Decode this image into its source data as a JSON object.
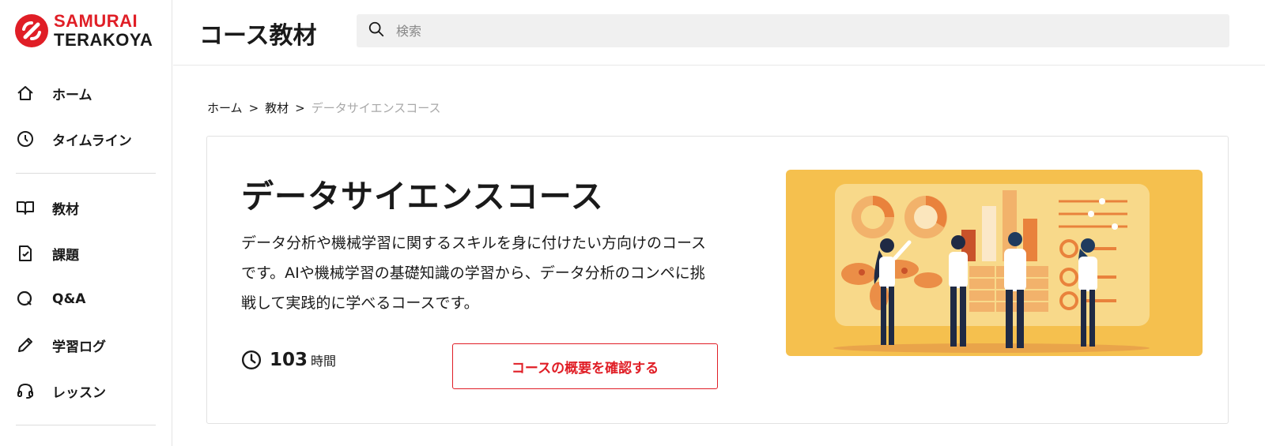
{
  "brand": {
    "line1": "SAMURAI",
    "line2": "TERAKOYA",
    "accent_color": "#e01e26"
  },
  "sidebar": {
    "items": [
      {
        "label": "ホーム",
        "icon": "home-icon"
      },
      {
        "label": "タイムライン",
        "icon": "clock-icon"
      },
      {
        "label": "教材",
        "icon": "book-icon"
      },
      {
        "label": "課題",
        "icon": "assignment-icon"
      },
      {
        "label": "Q&A",
        "icon": "qa-icon"
      },
      {
        "label": "学習ログ",
        "icon": "pencil-icon"
      },
      {
        "label": "レッスン",
        "icon": "headset-icon"
      }
    ]
  },
  "header": {
    "title": "コース教材",
    "search_placeholder": "検索"
  },
  "breadcrumb": {
    "home": "ホーム",
    "materials": "教材",
    "current": "データサイエンスコース",
    "separator": ">"
  },
  "course": {
    "title": "データサイエンスコース",
    "description": "データ分析や機械学習に関するスキルを身に付けたい方向けのコースです。AIや機械学習の基礎知識の学習から、データ分析のコンペに挑戦して実践的に学べるコースです。",
    "duration_value": "103",
    "duration_unit": "時間",
    "overview_button": "コースの概要を確認する",
    "thumbnail_bg": "#f5c04e"
  }
}
